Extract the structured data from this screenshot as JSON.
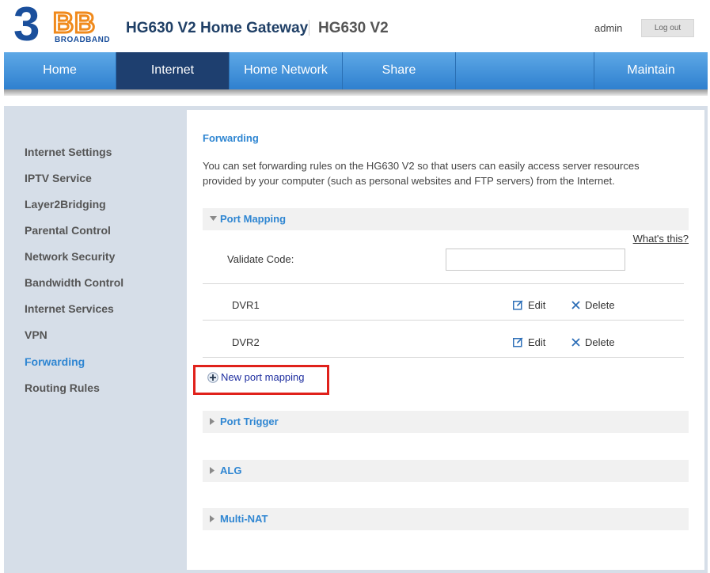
{
  "header": {
    "logo_number": "3",
    "logo_letters": "BB",
    "logo_subtitle": "BROADBAND",
    "title": "HG630 V2 Home Gateway",
    "subtitle": "HG630 V2",
    "user": "admin",
    "logout_label": "Log out"
  },
  "nav": {
    "items": [
      {
        "label": "Home"
      },
      {
        "label": "Internet"
      },
      {
        "label": "Home Network"
      },
      {
        "label": "Share"
      },
      {
        "label": ""
      },
      {
        "label": "Maintain"
      }
    ],
    "active_index": 1
  },
  "sidebar": {
    "items": [
      {
        "label": "Internet Settings"
      },
      {
        "label": "IPTV Service"
      },
      {
        "label": "Layer2Bridging"
      },
      {
        "label": "Parental Control"
      },
      {
        "label": "Network Security"
      },
      {
        "label": "Bandwidth Control"
      },
      {
        "label": "Internet Services"
      },
      {
        "label": "VPN"
      },
      {
        "label": "Forwarding"
      },
      {
        "label": "Routing Rules"
      }
    ],
    "active_index": 8
  },
  "main": {
    "section_title": "Forwarding",
    "description": "You can set forwarding rules on the HG630 V2 so that users can easily access server resources provided by your computer (such as personal websites and FTP servers) from the Internet.",
    "port_mapping": {
      "title": "Port Mapping",
      "whats_this": "What's this?",
      "validate_label": "Validate Code:",
      "validate_value": "",
      "rows": [
        {
          "name": "DVR1",
          "edit": "Edit",
          "delete": "Delete"
        },
        {
          "name": "DVR2",
          "edit": "Edit",
          "delete": "Delete"
        }
      ],
      "new_label": "New port mapping"
    },
    "collapsed_sections": [
      {
        "title": "Port Trigger"
      },
      {
        "title": "ALG"
      },
      {
        "title": "Multi-NAT"
      }
    ]
  },
  "colors": {
    "accent": "#2f86d2",
    "nav_active": "#1e3f6f",
    "logo_blue": "#1a4f9c",
    "logo_orange": "#f08a1c",
    "highlight_red": "#e0211b"
  }
}
